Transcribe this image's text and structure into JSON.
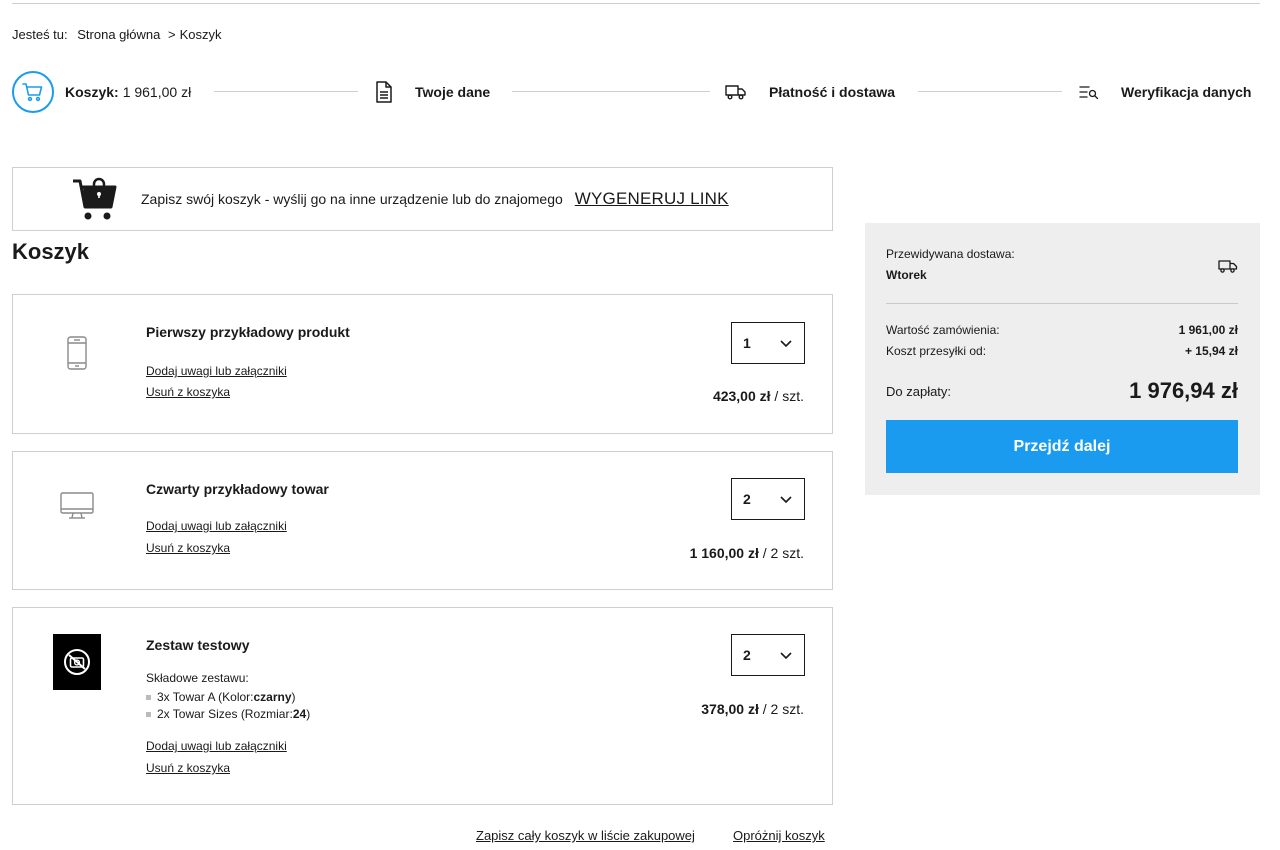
{
  "breadcrumb": {
    "prefix": "Jesteś tu:",
    "home": "Strona główna",
    "separator": ">",
    "current": "Koszyk"
  },
  "steps": {
    "cart_label": "Koszyk:",
    "cart_value": "1 961,00 zł",
    "your_data": "Twoje dane",
    "payment": "Płatność i dostawa",
    "verification": "Weryfikacja danych"
  },
  "save_banner": {
    "text": "Zapisz swój koszyk - wyślij go na inne urządzenie lub do znajomego",
    "link": "WYGENERUJ LINK"
  },
  "cart_title": "Koszyk",
  "items": [
    {
      "name": "Pierwszy przykładowy produkt",
      "icon": "smartphone-icon",
      "add_notes": "Dodaj uwagi lub załączniki",
      "remove": "Usuń z koszyka",
      "qty": "1",
      "price": "423,00 zł",
      "unit": " / szt."
    },
    {
      "name": "Czwarty przykładowy towar",
      "icon": "monitor-icon",
      "add_notes": "Dodaj uwagi lub załączniki",
      "remove": "Usuń z koszyka",
      "qty": "2",
      "price": "1 160,00 zł",
      "unit": " / 2 szt."
    },
    {
      "name": "Zestaw testowy",
      "icon": "no-photo-icon",
      "set_title": "Składowe zestawu:",
      "set_lines": [
        {
          "text": "3x Towar A (Kolor: ",
          "bold": "czarny",
          "end": ")"
        },
        {
          "text": "2x Towar Sizes (Rozmiar: ",
          "bold": "24",
          "end": ")"
        }
      ],
      "add_notes": "Dodaj uwagi lub załączniki",
      "remove": "Usuń z koszyka",
      "qty": "2",
      "price": "378,00 zł",
      "unit": " / 2 szt."
    }
  ],
  "bottom_links": {
    "save_list": "Zapisz cały koszyk w liście zakupowej",
    "empty": "Opróżnij koszyk"
  },
  "summary": {
    "delivery_label": "Przewidywana dostawa:",
    "delivery_day": "Wtorek",
    "order_value_label": "Wartość zamówienia:",
    "order_value": "1 961,00 zł",
    "shipping_label": "Koszt przesyłki od:",
    "shipping_value": "+ 15,94 zł",
    "total_label": "Do zapłaty:",
    "total_value": "1 976,94 zł",
    "proceed": "Przejdź dalej"
  },
  "colors": {
    "accent": "#1a9bf0",
    "summary_bg": "#eeeeee",
    "border": "#cfcfcf"
  }
}
